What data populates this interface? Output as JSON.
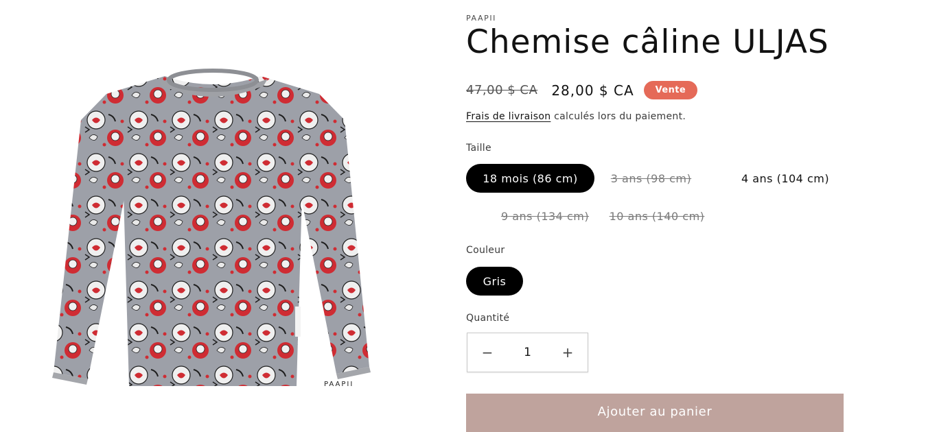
{
  "product": {
    "vendor": "PAAPII",
    "title": "Chemise câline ULJAS",
    "image_alt": "Chemise câline ULJAS",
    "price": {
      "regular": "47,00 $ CA",
      "sale": "28,00 $ CA",
      "badge": "Vente",
      "badge_color": "#e56a58"
    },
    "shipping": {
      "link_text": "Frais de livraison",
      "rest": " calculés lors du paiement."
    },
    "size": {
      "label": "Taille",
      "options": [
        {
          "label": "18 mois (86 cm)",
          "state": "selected"
        },
        {
          "label": "3 ans (98 cm)",
          "state": "unavailable"
        },
        {
          "label": "4 ans (104 cm)",
          "state": "available"
        },
        {
          "label": "9 ans (134 cm)",
          "state": "unavailable"
        },
        {
          "label": "10 ans (140 cm)",
          "state": "unavailable"
        }
      ]
    },
    "color": {
      "label": "Couleur",
      "options": [
        {
          "label": "Gris",
          "state": "selected"
        }
      ]
    },
    "quantity": {
      "label": "Quantité",
      "value": "1",
      "decrease_icon": "minus-icon",
      "increase_icon": "plus-icon"
    },
    "add_to_cart": {
      "label": "Ajouter au panier",
      "color": "#bfa39d"
    }
  }
}
